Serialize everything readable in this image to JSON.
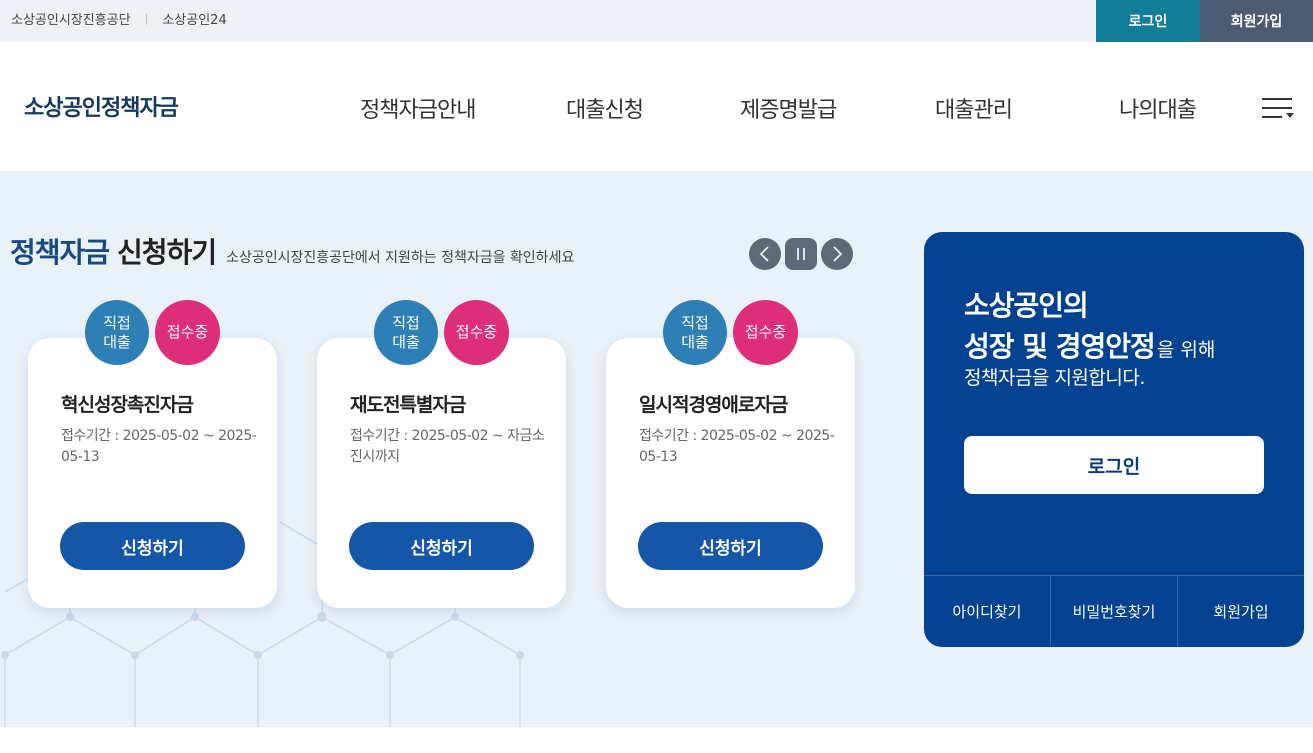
{
  "util": {
    "links": [
      "소상공인시장진흥공단",
      "소상공인24"
    ],
    "separator": "|",
    "login_label": "로그인",
    "join_label": "회원가입"
  },
  "header": {
    "logo": "소상공인정책자금",
    "nav": [
      "정책자금안내",
      "대출신청",
      "제증명발급",
      "대출관리",
      "나의대출"
    ],
    "menu_icon": "hamburger-menu-icon"
  },
  "section": {
    "title_highlight": "정책자금",
    "title_rest": "신청하기",
    "description": "소상공인시장진흥공단에서 지원하는 정책자금을 확인하세요"
  },
  "cards": [
    {
      "badge_type": "직접\n대출",
      "badge_status": "접수중",
      "name": "혁신성장촉진자금",
      "period": "접수기간 : 2025-05-02 ~ 2025-05-13",
      "button": "신청하기"
    },
    {
      "badge_type": "직접\n대출",
      "badge_status": "접수중",
      "name": "재도전특별자금",
      "period": "접수기간 : 2025-05-02 ~ 자금소진시까지",
      "button": "신청하기"
    },
    {
      "badge_type": "직접\n대출",
      "badge_status": "접수중",
      "name": "일시적경영애로자금",
      "period": "접수기간 : 2025-05-02 ~ 2025-05-13",
      "button": "신청하기"
    }
  ],
  "login_panel": {
    "line1": "소상공인의",
    "line2_strong": "성장 및 경영안정",
    "line2_rest": "을 위해",
    "line3": "정책자금을 지원합니다.",
    "login_button": "로그인",
    "links": [
      "아이디찾기",
      "비밀번호찾기",
      "회원가입"
    ]
  },
  "colors": {
    "login_top": "#127d96",
    "join_top": "#4b5c72",
    "panel": "#034191",
    "apply_button": "#1656a8",
    "badge_blue": "#2d7fb5",
    "badge_pink": "#de2d79"
  }
}
